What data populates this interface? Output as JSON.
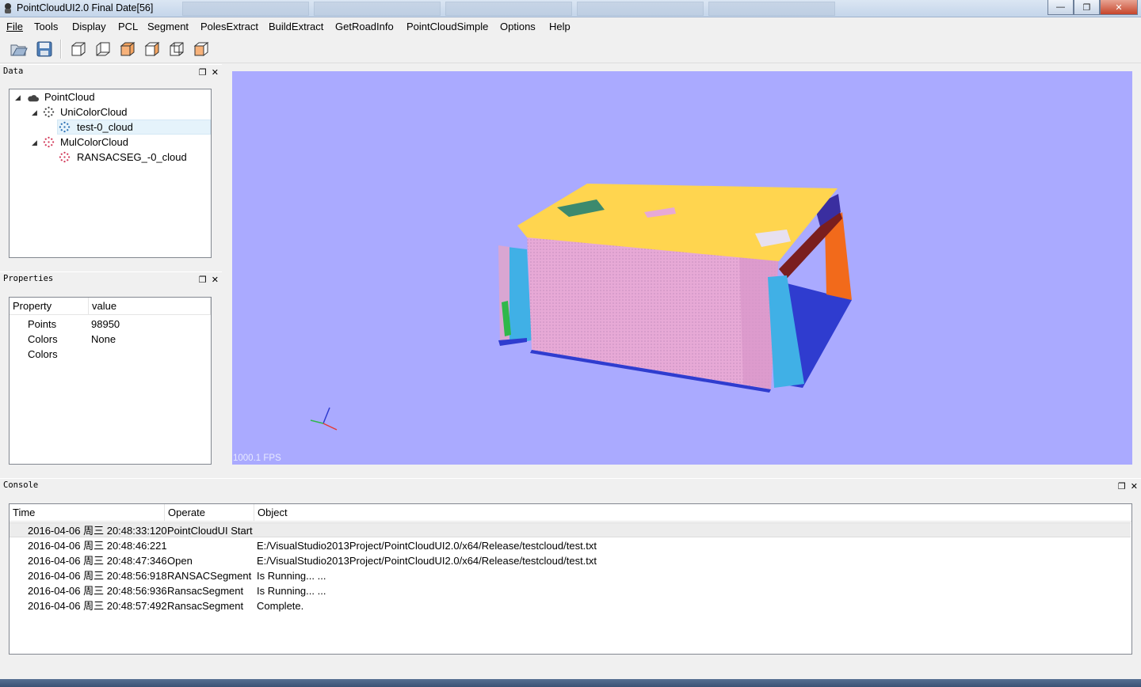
{
  "window": {
    "title": "PointCloudUI2.0  Final Date[56]"
  },
  "menu": [
    "File",
    "Tools",
    "Display",
    "PCL",
    "Segment",
    "PolesExtract",
    "BuildExtract",
    "GetRoadInfo",
    "PointCloudSimple",
    "Options",
    "Help"
  ],
  "toolbar": {
    "icons": [
      "open-folder-icon",
      "save-icon",
      "view-front-icon",
      "view-back-icon",
      "view-top-icon",
      "view-bottom-icon",
      "view-left-icon",
      "view-right-icon"
    ]
  },
  "data_dock": {
    "title": "Data",
    "tree": {
      "root": "PointCloud",
      "groups": [
        {
          "label": "UniColorCloud",
          "children": [
            "test-0_cloud"
          ]
        },
        {
          "label": "MulColorCloud",
          "children": [
            "RANSACSEG_-0_cloud"
          ]
        }
      ],
      "selected": "test-0_cloud"
    }
  },
  "properties_dock": {
    "title": "Properties",
    "headers": [
      "Property",
      "value"
    ],
    "rows": [
      {
        "property": "Points",
        "value": "98950"
      },
      {
        "property": "Colors",
        "value": "None"
      },
      {
        "property": "Colors",
        "value": ""
      }
    ]
  },
  "viewer": {
    "fps": "1000.1 FPS",
    "background_color": "#aaaaff",
    "segment_colors": [
      "#ffd54f",
      "#e7a9d6",
      "#40b0e6",
      "#2f3ccf",
      "#f26a1b",
      "#7a1e1e",
      "#3c8a6e",
      "#2fb84a",
      "#3a2ea0"
    ]
  },
  "console": {
    "title": "Console",
    "headers": [
      "Time",
      "Operate",
      "Object"
    ],
    "rows": [
      {
        "time": "2016-04-06 周三 20:48:33:120",
        "operate": "PointCloudUI Start",
        "object": ""
      },
      {
        "time": "2016-04-06 周三 20:48:46:221",
        "operate": "",
        "object": "E:/VisualStudio2013Project/PointCloudUI2.0/x64/Release/testcloud/test.txt"
      },
      {
        "time": "2016-04-06 周三 20:48:47:346",
        "operate": "Open",
        "object": "E:/VisualStudio2013Project/PointCloudUI2.0/x64/Release/testcloud/test.txt"
      },
      {
        "time": "2016-04-06 周三 20:48:56:918",
        "operate": "RANSACSegment",
        "object": "Is Running... ..."
      },
      {
        "time": "2016-04-06 周三 20:48:56:936",
        "operate": "RansacSegment",
        "object": "Is Running... ..."
      },
      {
        "time": "2016-04-06 周三 20:48:57:492",
        "operate": "RansacSegment",
        "object": "Complete."
      }
    ]
  }
}
